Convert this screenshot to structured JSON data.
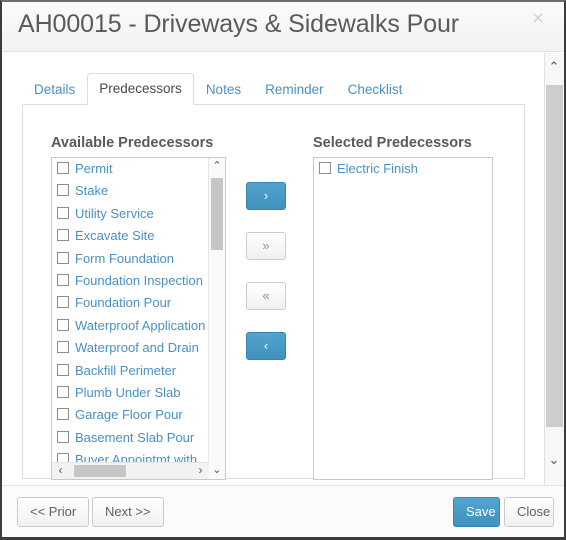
{
  "window": {
    "title": "AH00015 - Driveways & Sidewalks Pour",
    "close_icon": "×"
  },
  "tabs": [
    {
      "label": "Details",
      "active": false
    },
    {
      "label": "Predecessors",
      "active": true
    },
    {
      "label": "Notes",
      "active": false
    },
    {
      "label": "Reminder",
      "active": false
    },
    {
      "label": "Checklist",
      "active": false
    }
  ],
  "predecessors": {
    "available_heading": "Available Predecessors",
    "selected_heading": "Selected Predecessors",
    "available_items": [
      "Permit",
      "Stake",
      "Utility Service",
      "Excavate Site",
      "Form Foundation",
      "Foundation Inspection",
      "Foundation Pour",
      "Waterproof Application",
      "Waterproof and Drain",
      "Backfill Perimeter",
      "Plumb Under Slab",
      "Garage Floor Pour",
      "Basement Slab Pour",
      "Buyer Appointmt with"
    ],
    "selected_items": [
      "Electric Finish"
    ],
    "transfer_buttons": {
      "move_right": "›",
      "move_all_right": "»",
      "move_all_left": "«",
      "move_left": "‹"
    },
    "scroll_icons": {
      "up": "⌃",
      "down": "⌄",
      "left": "‹",
      "right": "›"
    }
  },
  "footer": {
    "prior_label": "<< Prior",
    "next_label": "Next >>",
    "save_label": "Save",
    "close_label": "Close"
  },
  "colors": {
    "accent": "#3f92bf",
    "link": "#4a90c4",
    "title_text": "#5a5a5a"
  }
}
